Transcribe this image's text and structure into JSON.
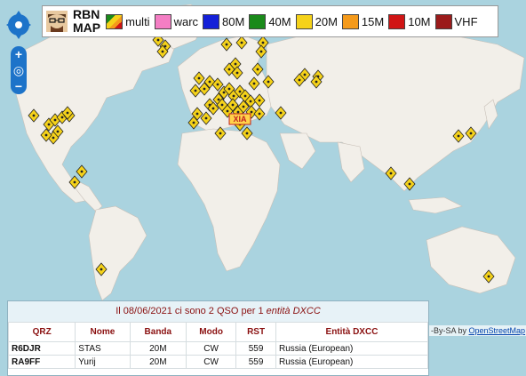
{
  "app": {
    "title_line1": "RBN",
    "title_line2": "MAP"
  },
  "legend": [
    {
      "label": "multi",
      "color": "multi"
    },
    {
      "label": "warc",
      "color": "#f47ec4"
    },
    {
      "label": "80M",
      "color": "#1420d8"
    },
    {
      "label": "40M",
      "color": "#1a8a1a"
    },
    {
      "label": "20M",
      "color": "#f5d21a"
    },
    {
      "label": "15M",
      "color": "#f59a1a"
    },
    {
      "label": "10M",
      "color": "#d01515"
    },
    {
      "label": "VHF",
      "color": "#9b1b1b"
    }
  ],
  "colors": {
    "water": "#aad3df",
    "land": "#f2efe9",
    "marker": "#f5d21a",
    "marker_stroke": "#222222"
  },
  "center_label": "XIA",
  "panel": {
    "title_prefix": "Il 08/06/2021 ci sono 2 QSO per 1 ",
    "title_em": "entità DXCC",
    "columns": [
      "QRZ",
      "Nome",
      "Banda",
      "Modo",
      "RST",
      "Entità DXCC"
    ],
    "rows": [
      [
        "R6DJR",
        "STAS",
        "20M",
        "CW",
        "559",
        "Russia (European)"
      ],
      [
        "RA9FF",
        "Yurij",
        "20M",
        "CW",
        "559",
        "Russia (European)"
      ]
    ]
  },
  "attribution": {
    "text": "-By-SA by ",
    "link": "OpenStreetMap"
  }
}
